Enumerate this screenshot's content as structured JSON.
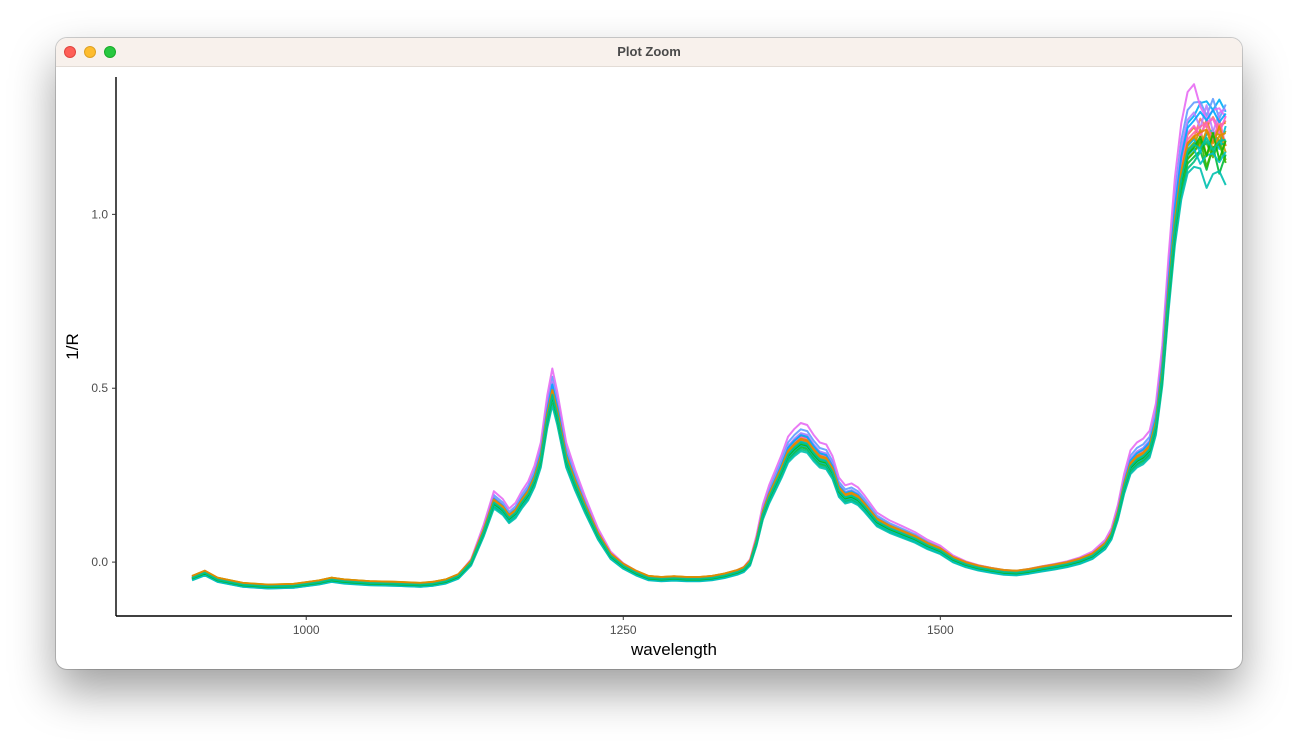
{
  "window": {
    "title": "Plot Zoom",
    "controls": [
      "close",
      "minimize",
      "zoom"
    ]
  },
  "chart_data": {
    "type": "line",
    "xlabel": "wavelength",
    "ylabel": "1/R",
    "xlim": [
      850,
      1730
    ],
    "ylim": [
      -0.155,
      1.395
    ],
    "xticks": [
      1000,
      1250,
      1500
    ],
    "xtick_labels": [
      "1000",
      "1250",
      "1500"
    ],
    "yticks": [
      0.0,
      0.5,
      1.0
    ],
    "ytick_labels": [
      "0.0",
      "0.5",
      "1.0"
    ],
    "grid": false,
    "legend": "none",
    "base_curve": {
      "x": [
        910,
        920,
        930,
        950,
        970,
        990,
        1010,
        1020,
        1030,
        1050,
        1070,
        1090,
        1100,
        1110,
        1120,
        1130,
        1140,
        1148,
        1155,
        1160,
        1165,
        1170,
        1175,
        1180,
        1185,
        1190,
        1194,
        1198,
        1205,
        1212,
        1220,
        1230,
        1240,
        1250,
        1260,
        1270,
        1280,
        1290,
        1300,
        1310,
        1320,
        1330,
        1340,
        1345,
        1350,
        1355,
        1360,
        1365,
        1370,
        1375,
        1380,
        1385,
        1390,
        1395,
        1400,
        1405,
        1410,
        1415,
        1420,
        1425,
        1430,
        1435,
        1440,
        1450,
        1460,
        1470,
        1480,
        1490,
        1500,
        1510,
        1520,
        1530,
        1540,
        1550,
        1560,
        1570,
        1580,
        1590,
        1600,
        1610,
        1620,
        1625,
        1630,
        1635,
        1640,
        1645,
        1650,
        1655,
        1660,
        1665,
        1670,
        1675,
        1680,
        1685,
        1690,
        1695,
        1700
      ],
      "y": [
        -0.045,
        -0.03,
        -0.05,
        -0.065,
        -0.07,
        -0.068,
        -0.058,
        -0.05,
        -0.055,
        -0.06,
        -0.062,
        -0.065,
        -0.062,
        -0.055,
        -0.04,
        0.0,
        0.09,
        0.175,
        0.155,
        0.13,
        0.145,
        0.175,
        0.2,
        0.24,
        0.3,
        0.42,
        0.49,
        0.43,
        0.3,
        0.23,
        0.16,
        0.08,
        0.02,
        -0.01,
        -0.03,
        -0.045,
        -0.048,
        -0.046,
        -0.048,
        -0.048,
        -0.045,
        -0.038,
        -0.028,
        -0.02,
        0.0,
        0.06,
        0.14,
        0.19,
        0.23,
        0.27,
        0.315,
        0.335,
        0.35,
        0.345,
        0.32,
        0.3,
        0.295,
        0.265,
        0.21,
        0.19,
        0.195,
        0.185,
        0.165,
        0.12,
        0.1,
        0.085,
        0.07,
        0.05,
        0.035,
        0.01,
        -0.005,
        -0.015,
        -0.022,
        -0.028,
        -0.03,
        -0.025,
        -0.018,
        -0.012,
        -0.005,
        0.005,
        0.02,
        0.035,
        0.05,
        0.08,
        0.14,
        0.22,
        0.28,
        0.3,
        0.31,
        0.33,
        0.4,
        0.55,
        0.78,
        0.98,
        1.12,
        1.2,
        1.22
      ]
    },
    "series": [
      {
        "color": "#F8766D",
        "offset": 0.0,
        "scale": 1.0,
        "end_y": 1.26
      },
      {
        "color": "#E7861B",
        "offset": 0.006,
        "scale": 1.02,
        "end_y": 1.24
      },
      {
        "color": "#C59900",
        "offset": 0.004,
        "scale": 0.98,
        "end_y": 1.2
      },
      {
        "color": "#A3A500",
        "offset": -0.004,
        "scale": 0.97,
        "end_y": 1.22
      },
      {
        "color": "#6BB100",
        "offset": -0.002,
        "scale": 0.99,
        "end_y": 1.18
      },
      {
        "color": "#00BA38",
        "offset": -0.006,
        "scale": 0.96,
        "end_y": 1.15
      },
      {
        "color": "#00BF7D",
        "offset": -0.008,
        "scale": 0.95,
        "end_y": 1.19
      },
      {
        "color": "#00C0AF",
        "offset": -0.01,
        "scale": 0.94,
        "end_y": 1.1
      },
      {
        "color": "#00BCD8",
        "offset": -0.004,
        "scale": 1.0,
        "end_y": 1.21
      },
      {
        "color": "#00B0F6",
        "offset": 0.002,
        "scale": 1.05,
        "end_y": 1.31
      },
      {
        "color": "#619CFF",
        "offset": 0.004,
        "scale": 1.08,
        "end_y": 1.3
      },
      {
        "color": "#B983FF",
        "offset": 0.0,
        "scale": 1.06,
        "end_y": 1.27
      },
      {
        "color": "#E76BF3",
        "offset": 0.008,
        "scale": 1.12,
        "end_y": 1.29
      },
      {
        "color": "#FD61D1",
        "offset": -0.002,
        "scale": 1.03,
        "end_y": 1.25
      },
      {
        "color": "#FF67A4",
        "offset": 0.003,
        "scale": 1.01,
        "end_y": 1.23
      },
      {
        "color": "#00A9FF",
        "offset": 0.001,
        "scale": 1.04,
        "end_y": 1.28
      },
      {
        "color": "#D89000",
        "offset": 0.005,
        "scale": 1.0,
        "end_y": 1.21
      },
      {
        "color": "#39B600",
        "offset": -0.005,
        "scale": 0.97,
        "end_y": 1.17
      },
      {
        "color": "#00BFC4",
        "offset": -0.007,
        "scale": 0.98,
        "end_y": 1.16
      },
      {
        "color": "#E58700",
        "offset": 0.003,
        "scale": 1.0,
        "end_y": 1.22
      },
      {
        "color": "#0CB702",
        "offset": -0.003,
        "scale": 0.98,
        "end_y": 1.19
      },
      {
        "color": "#00C19A",
        "offset": -0.001,
        "scale": 0.985,
        "end_y": 1.2
      }
    ]
  }
}
